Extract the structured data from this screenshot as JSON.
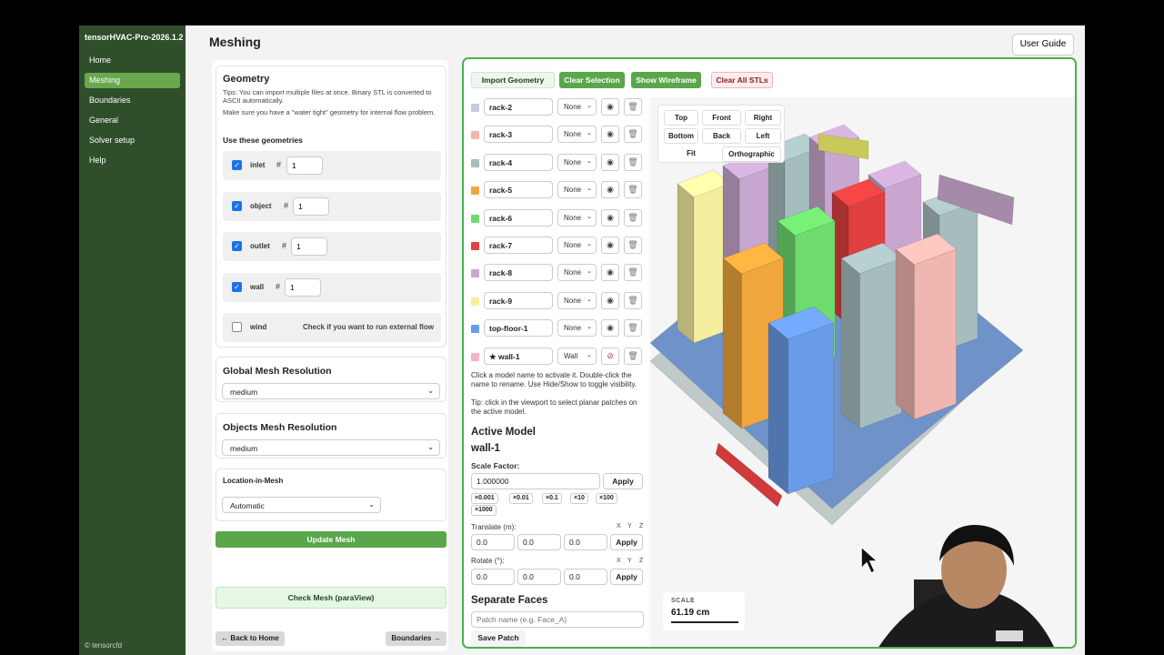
{
  "app": {
    "brand": "tensorHVAC-Pro-2026.1.2",
    "copyright": "© tensorcfd"
  },
  "nav": [
    {
      "label": "Home",
      "active": false
    },
    {
      "label": "Meshing",
      "active": true
    },
    {
      "label": "Boundaries",
      "active": false
    },
    {
      "label": "General",
      "active": false
    },
    {
      "label": "Solver setup",
      "active": false
    },
    {
      "label": "Help",
      "active": false
    }
  ],
  "page": {
    "title": "Meshing",
    "user_guide": "User Guide"
  },
  "geometry": {
    "title": "Geometry",
    "tip1": "Tips: You can import multiple files at once. Binary STL is converted to ASCII automatically.",
    "tip2": "Make sure you have a \"water tight\" geometry for internal flow problem.",
    "use_label": "Use these geometries",
    "items": [
      {
        "name": "inlet",
        "checked": true,
        "hash": "#",
        "value": "1"
      },
      {
        "name": "object",
        "checked": true,
        "hash": "#",
        "value": "1"
      },
      {
        "name": "outlet",
        "checked": true,
        "hash": "#",
        "value": "1"
      },
      {
        "name": "wall",
        "checked": true,
        "hash": "#",
        "value": "1"
      }
    ],
    "wind": {
      "name": "wind",
      "checked": false,
      "hint": "Check if you want to run external flow"
    }
  },
  "global_mesh": {
    "title": "Global Mesh Resolution",
    "value": "medium"
  },
  "objects_mesh": {
    "title": "Objects Mesh Resolution",
    "value": "medium"
  },
  "location": {
    "title": "Location-in-Mesh",
    "value": "Automatic"
  },
  "buttons": {
    "update_mesh": "Update Mesh",
    "check_mesh": "Check Mesh (paraView)",
    "back_home": "← Back to Home",
    "boundaries": "Boundaries →"
  },
  "toolbar": {
    "import": "Import Geometry",
    "clear_selection": "Clear Selection",
    "show_wireframe": "Show Wireframe",
    "clear_all": "Clear All STLs"
  },
  "models": [
    {
      "name": "rack-2",
      "type": "None",
      "color": "#c7cbe6"
    },
    {
      "name": "rack-3",
      "type": "None",
      "color": "#f0b7b0"
    },
    {
      "name": "rack-4",
      "type": "None",
      "color": "#a6bdbf"
    },
    {
      "name": "rack-5",
      "type": "None",
      "color": "#f0a63c"
    },
    {
      "name": "rack-6",
      "type": "None",
      "color": "#6edb6e"
    },
    {
      "name": "rack-7",
      "type": "None",
      "color": "#e04040"
    },
    {
      "name": "rack-8",
      "type": "None",
      "color": "#c9a6cf"
    },
    {
      "name": "rack-9",
      "type": "None",
      "color": "#f5f09a"
    },
    {
      "name": "top-floor-1",
      "type": "None",
      "color": "#6a9be8"
    },
    {
      "name": "★ wall-1",
      "type": "Wall",
      "color": "#f2b4c4"
    }
  ],
  "help_text": "Click a model name to activate it. Double-click the name to rename. Use Hide/Show to toggle visibility.",
  "tip_text": "Tip: click in the viewport to select planar patches on the active model.",
  "active_model": {
    "title": "Active Model",
    "name": "wall-1",
    "scale_label": "Scale Factor:",
    "scale_value": "1.000000",
    "apply": "Apply",
    "chips": [
      "×0.001",
      "×0.01",
      "×0.1",
      "×10",
      "×100",
      "×1000"
    ],
    "translate_label": "Translate (m):",
    "translate": [
      "0.0",
      "0.0",
      "0.0"
    ],
    "rotate_label": "Rotate (°):",
    "rotate": [
      "0.0",
      "0.0",
      "0.0"
    ],
    "axes": [
      "X",
      "Y",
      "Z"
    ]
  },
  "separate_faces": {
    "title": "Separate Faces",
    "placeholder": "Patch name (e.g. Face_A)",
    "save": "Save Patch"
  },
  "view_buttons": [
    "Top",
    "Front",
    "Right",
    "Bottom",
    "Back",
    "Left",
    "Fit",
    "Orthographic"
  ],
  "scale": {
    "label": "SCALE",
    "value": "61.19 cm"
  }
}
